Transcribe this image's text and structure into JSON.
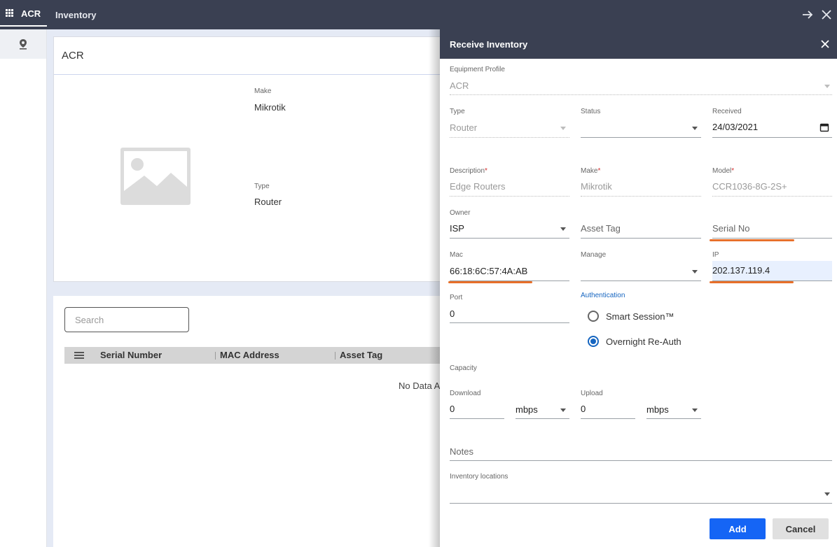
{
  "header": {
    "app_tab": "ACR",
    "section_tab": "Inventory",
    "icons": {
      "apps": "grid-icon",
      "forward": "arrow-right-icon",
      "close": "close-icon"
    }
  },
  "rail": {
    "items": [
      {
        "icon": "location-pin-icon"
      }
    ]
  },
  "profile_card": {
    "title": "ACR",
    "make_label": "Make",
    "make_value": "Mikrotik",
    "type_label": "Type",
    "type_value": "Router",
    "image_icon": "image-placeholder-icon"
  },
  "inventory_card": {
    "search_placeholder": "Search",
    "columns": [
      "Serial Number",
      "MAC Address",
      "Asset Tag"
    ],
    "empty_text": "No Data A"
  },
  "drawer": {
    "title": "Receive Inventory",
    "equipment_profile": {
      "label": "Equipment Profile",
      "value": "ACR"
    },
    "type": {
      "label": "Type",
      "value": "Router"
    },
    "status": {
      "label": "Status",
      "value": ""
    },
    "received": {
      "label": "Received",
      "value": "24/03/2021"
    },
    "description": {
      "label": "Description",
      "value": "Edge Routers",
      "required": "*"
    },
    "make": {
      "label": "Make",
      "value": "Mikrotik",
      "required": "*"
    },
    "model": {
      "label": "Model",
      "value": "CCR1036-8G-2S+",
      "required": "*"
    },
    "owner": {
      "label": "Owner",
      "value": "ISP"
    },
    "asset_tag": {
      "placeholder": "Asset Tag"
    },
    "serial_no": {
      "placeholder": "Serial No"
    },
    "mac": {
      "label": "Mac",
      "value": "66:18:6C:57:4A:AB"
    },
    "manage": {
      "label": "Manage",
      "value": ""
    },
    "ip": {
      "label": "IP",
      "value": "202.137.119.4"
    },
    "port": {
      "label": "Port",
      "value": "0"
    },
    "authentication": {
      "label": "Authentication",
      "options": [
        {
          "label": "Smart Session™",
          "selected": false
        },
        {
          "label": "Overnight Re-Auth",
          "selected": true
        }
      ]
    },
    "capacity": {
      "label": "Capacity"
    },
    "download": {
      "label": "Download",
      "value": "0",
      "unit": "mbps"
    },
    "upload": {
      "label": "Upload",
      "value": "0",
      "unit": "mbps"
    },
    "notes": {
      "placeholder": "Notes"
    },
    "inventory_locations": {
      "label": "Inventory locations",
      "value": ""
    },
    "add_label": "Add",
    "cancel_label": "Cancel"
  },
  "colors": {
    "header_bg": "#3a4052",
    "primary": "#1565f5",
    "highlight": "#e8702a",
    "autofill_bg": "#e8f0fe"
  }
}
